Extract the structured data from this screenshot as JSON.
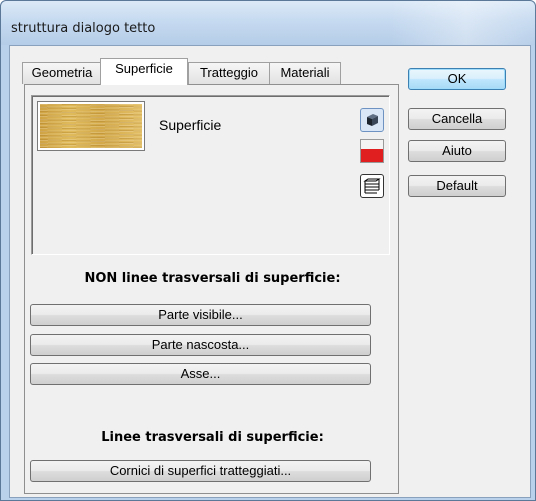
{
  "window": {
    "title": "struttura dialogo tetto"
  },
  "tabs": [
    {
      "label": "Geometria"
    },
    {
      "label": "Superficie"
    },
    {
      "label": "Tratteggio"
    },
    {
      "label": "Materiali"
    }
  ],
  "active_tab": "Superficie",
  "preview": {
    "surface_label": "Superficie"
  },
  "section_non": {
    "heading": "NON linee trasversali di superficie:"
  },
  "non_buttons": [
    {
      "label": "Parte visibile..."
    },
    {
      "label": "Parte nascosta..."
    },
    {
      "label": "Asse..."
    }
  ],
  "section_lines": {
    "heading": "Linee trasversali di superficie:"
  },
  "lines_buttons": [
    {
      "label": "Cornici di superfici tratteggiati..."
    }
  ],
  "side_buttons": {
    "ok": "OK",
    "cancel": "Cancella",
    "help": "Aiuto",
    "default": "Default"
  },
  "colors": {
    "surface_swatch": "#d9b050",
    "selected_color": "#e02020",
    "title_bar": "#c6daf0"
  },
  "icons": {
    "cube": "3d-cube-icon",
    "color": "color-picker-icon",
    "hatch": "hatch-pattern-icon"
  }
}
